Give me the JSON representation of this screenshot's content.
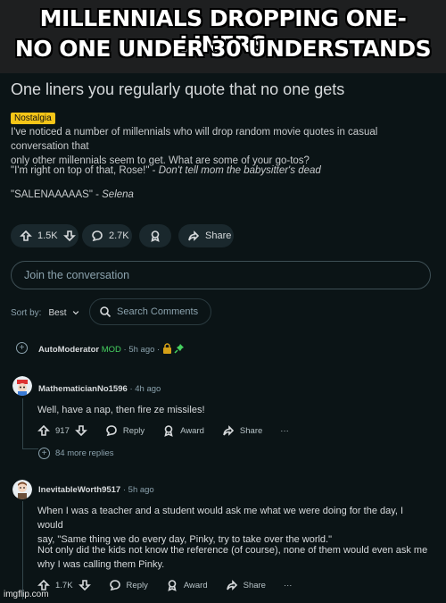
{
  "meme": {
    "line1": "MILLENNIALS DROPPING ONE-LINERS",
    "line2": "NO ONE UNDER 30 UNDERSTANDS"
  },
  "post": {
    "title": "One liners you regularly quote that no one gets",
    "flair": "Nostalgia",
    "body_line1": "I've noticed a number of millennials who will drop random movie quotes in casual conversation that",
    "body_line2": "only other millennials seem to get. What are some of your go-tos?",
    "quote1_text": "\"I'm right on top of that, Rose!\" - ",
    "quote1_source": "Don't tell mom the babysitter's dead",
    "quote2_text": "\"SALENAAAAAS\" - ",
    "quote2_source": "Selena",
    "votes": "1.5K",
    "comments": "2.7K",
    "share_label": "Share"
  },
  "join": {
    "placeholder": "Join the conversation"
  },
  "sort": {
    "label": "Sort by:",
    "value": "Best",
    "search_placeholder": "Search Comments"
  },
  "comments": [
    {
      "user": "AutoModerator",
      "mod": "MOD",
      "time": "· 5h ago ·"
    },
    {
      "user": "MathematicianNo1596",
      "time": "· 4h ago",
      "text": "Well, have a nap, then fire ze missiles!",
      "votes": "917",
      "reply": "Reply",
      "award": "Award",
      "share": "Share",
      "more": "···",
      "more_replies": "84 more replies"
    },
    {
      "user": "InevitableWorth9517",
      "time": "· 5h ago",
      "text_line1": "When I was a teacher and a student would ask me what we were doing for the day, I would",
      "text_line2": "say, \"Same thing we do every day, Pinky, try to take over the world.\"",
      "text_line3": "Not only did the kids not know the reference (of course), none of them would even ask me",
      "text_line4": "why I was calling them Pinky.",
      "votes": "1.7K",
      "reply": "Reply",
      "award": "Award",
      "share": "Share",
      "more": "···"
    }
  ],
  "watermark": "imgflip.com",
  "colors": {
    "background": "#0b1416",
    "flair": "#f5c518",
    "mod": "#46d160",
    "lock": "#d4a017"
  },
  "icons": [
    "upvote-icon",
    "downvote-icon",
    "comment-icon",
    "award-icon",
    "share-icon",
    "search-icon",
    "chevron-down-icon",
    "lock-icon",
    "pin-icon",
    "plus-icon"
  ]
}
